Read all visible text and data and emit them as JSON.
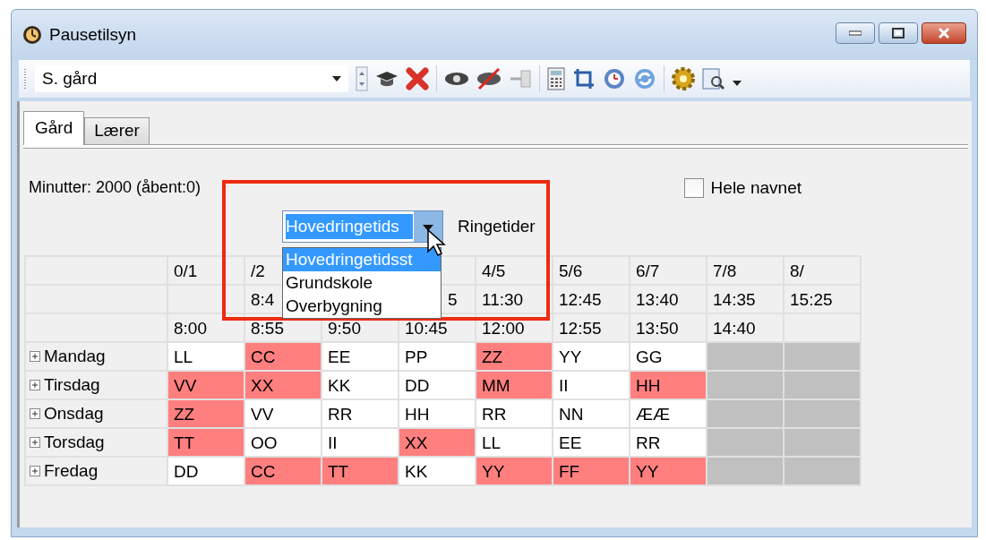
{
  "window": {
    "title": "Pausetilsyn"
  },
  "toolbar": {
    "selector_value": "S. gård"
  },
  "tabs": [
    {
      "label": "Gård",
      "selected": true
    },
    {
      "label": "Lærer",
      "selected": false
    }
  ],
  "minutes_label": "Minutter: 2000 (åbent:0)",
  "full_name_checkbox": {
    "label": "Hele navnet",
    "checked": false
  },
  "bell_schedule": {
    "value": "Hovedringetids",
    "label": "Ringetider",
    "options": [
      {
        "label": "Hovedringetidsst",
        "selected": true
      },
      {
        "label": "Grundskole",
        "selected": false
      },
      {
        "label": "Overbygning",
        "selected": false
      }
    ]
  },
  "table": {
    "header_rows": [
      [
        null,
        "0/1",
        "/2",
        null,
        null,
        "4/5",
        "5/6",
        "6/7",
        "7/8",
        "8/"
      ],
      [
        null,
        null,
        "8:4",
        null,
        "5",
        "11:30",
        "12:45",
        "13:40",
        "14:35",
        "15:25"
      ],
      [
        null,
        "8:00",
        "8:55",
        "9:50",
        "10:45",
        "12:00",
        "12:55",
        "13:50",
        "14:40",
        null
      ]
    ],
    "rows": [
      {
        "day": "Mandag",
        "expanded": false,
        "cells": [
          {
            "text": "LL",
            "highlighted": false
          },
          {
            "text": "CC",
            "highlighted": true
          },
          {
            "text": "EE",
            "highlighted": false
          },
          {
            "text": "PP",
            "highlighted": false
          },
          {
            "text": "ZZ",
            "highlighted": true
          },
          {
            "text": "YY",
            "highlighted": false
          },
          {
            "text": "GG",
            "highlighted": false
          },
          {
            "kind": "blocked"
          },
          {
            "kind": "blocked"
          }
        ]
      },
      {
        "day": "Tirsdag",
        "expanded": false,
        "cells": [
          {
            "text": "VV",
            "highlighted": true
          },
          {
            "text": "XX",
            "highlighted": true
          },
          {
            "text": "KK",
            "highlighted": false
          },
          {
            "text": "DD",
            "highlighted": false
          },
          {
            "text": "MM",
            "highlighted": true
          },
          {
            "text": "II",
            "highlighted": false
          },
          {
            "text": "HH",
            "highlighted": true
          },
          {
            "kind": "blocked"
          },
          {
            "kind": "blocked"
          }
        ]
      },
      {
        "day": "Onsdag",
        "expanded": false,
        "cells": [
          {
            "text": "ZZ",
            "highlighted": true
          },
          {
            "text": "VV",
            "highlighted": false
          },
          {
            "text": "RR",
            "highlighted": false
          },
          {
            "text": "HH",
            "highlighted": false
          },
          {
            "text": "RR",
            "highlighted": false
          },
          {
            "text": "NN",
            "highlighted": false
          },
          {
            "text": "ÆÆ",
            "highlighted": false
          },
          {
            "kind": "blocked"
          },
          {
            "kind": "blocked"
          }
        ]
      },
      {
        "day": "Torsdag",
        "expanded": false,
        "cells": [
          {
            "text": "TT",
            "highlighted": true
          },
          {
            "text": "OO",
            "highlighted": false
          },
          {
            "text": "II",
            "highlighted": false
          },
          {
            "text": "XX",
            "highlighted": true
          },
          {
            "text": "LL",
            "highlighted": false
          },
          {
            "text": "EE",
            "highlighted": false
          },
          {
            "text": "RR",
            "highlighted": false
          },
          {
            "kind": "blocked"
          },
          {
            "kind": "blocked"
          }
        ]
      },
      {
        "day": "Fredag",
        "expanded": false,
        "cells": [
          {
            "text": "DD",
            "highlighted": false
          },
          {
            "text": "CC",
            "highlighted": true
          },
          {
            "text": "TT",
            "highlighted": true
          },
          {
            "text": "KK",
            "highlighted": false
          },
          {
            "text": "YY",
            "highlighted": true
          },
          {
            "text": "FF",
            "highlighted": true
          },
          {
            "text": "YY",
            "highlighted": true
          },
          {
            "kind": "blocked"
          },
          {
            "kind": "blocked"
          }
        ]
      }
    ]
  }
}
